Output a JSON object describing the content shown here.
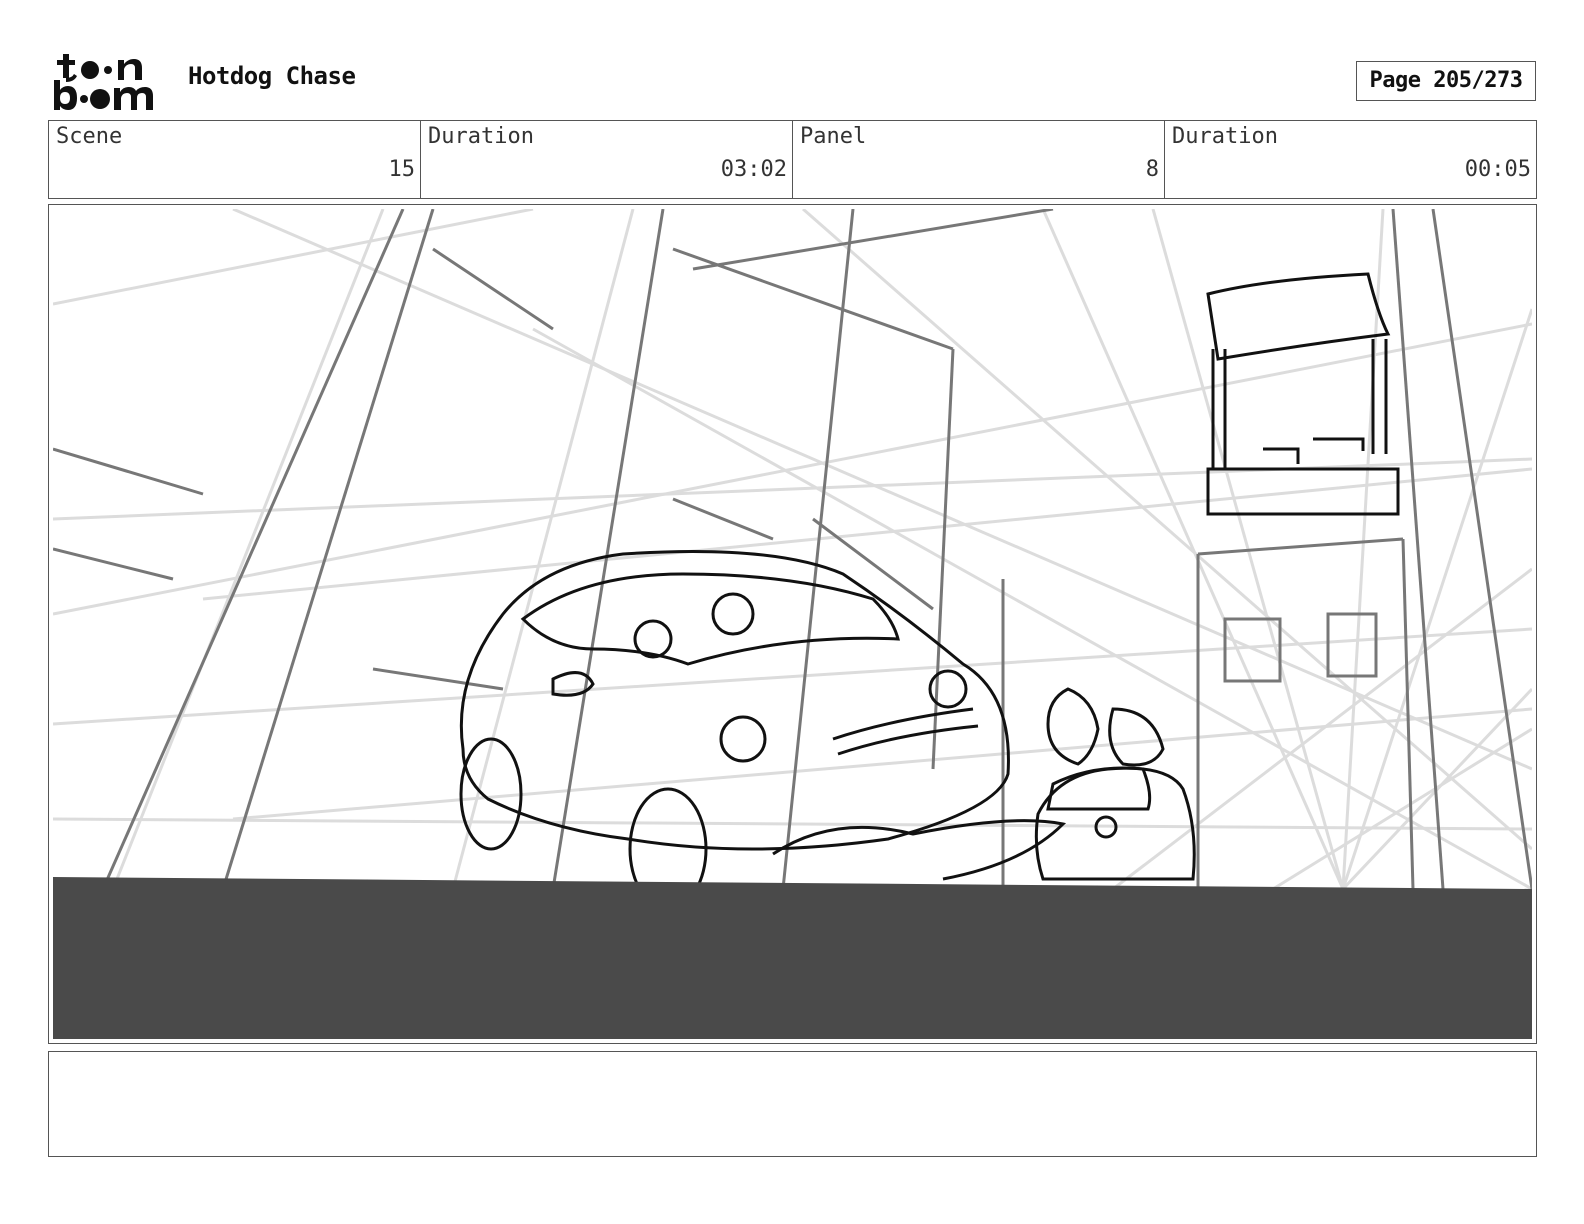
{
  "header": {
    "logo_text_top": "toon",
    "logo_text_bottom": "boom",
    "project_title": "Hotdog Chase",
    "page_indicator": "Page 205/273"
  },
  "info": [
    {
      "label": "Scene",
      "value": "15"
    },
    {
      "label": "Duration",
      "value": "03:02"
    },
    {
      "label": "Panel",
      "value": "8"
    },
    {
      "label": "Duration",
      "value": "00:05"
    }
  ],
  "panel": {
    "description": "",
    "colors": {
      "ground": "#4a4a4a",
      "lines_light": "#d8d8d8",
      "lines_mid": "#777777",
      "ink": "#111111"
    }
  },
  "notes": {
    "text": ""
  }
}
